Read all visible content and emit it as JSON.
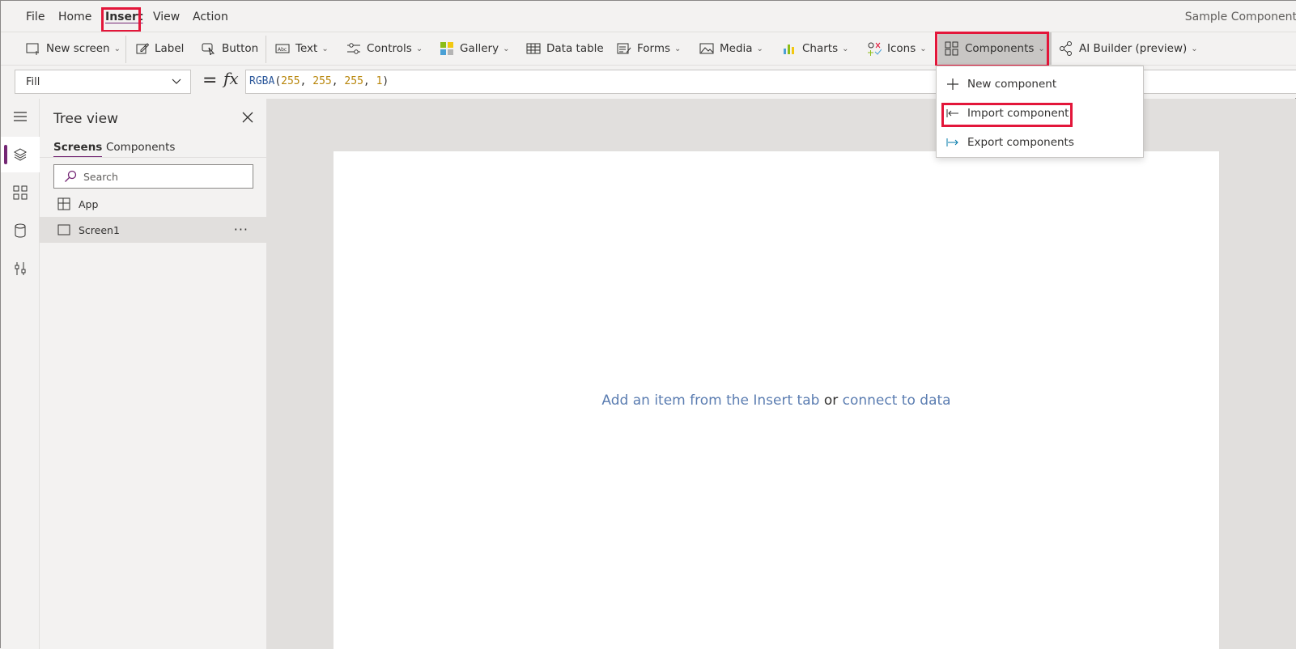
{
  "menu": {
    "items": [
      "File",
      "Home",
      "Insert",
      "View",
      "Action"
    ],
    "active": "Insert"
  },
  "app_title": "Sample Component",
  "ribbon": {
    "new_screen": "New screen",
    "label": "Label",
    "button": "Button",
    "text": "Text",
    "controls": "Controls",
    "gallery": "Gallery",
    "data_table": "Data table",
    "forms": "Forms",
    "media": "Media",
    "charts": "Charts",
    "icons": "Icons",
    "components": "Components",
    "ai_builder": "AI Builder (preview)"
  },
  "formula": {
    "property": "Fill",
    "equals": "=",
    "fx": "fx",
    "expression": {
      "fn": "RGBA",
      "r": "255",
      "g": "255",
      "b": "255",
      "a": "1"
    }
  },
  "tree": {
    "title": "Tree view",
    "tabs": [
      "Screens",
      "Components"
    ],
    "search_placeholder": "Search",
    "items": [
      "App",
      "Screen1"
    ],
    "more": "···"
  },
  "canvas": {
    "hint_link1": "Add an item from the Insert tab",
    "hint_or": "or",
    "hint_link2": "connect to data"
  },
  "components_menu": {
    "items": [
      "New component",
      "Import component",
      "Export components"
    ]
  },
  "colors": {
    "accent": "#742774",
    "highlight": "#e3163a",
    "link": "#5b7db1"
  }
}
